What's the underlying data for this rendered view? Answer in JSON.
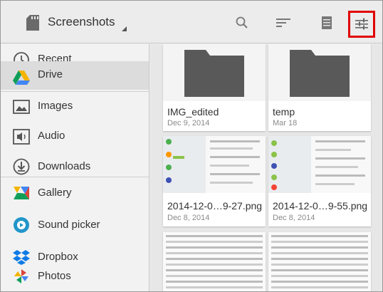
{
  "topbar": {
    "title": "Screenshots",
    "icons": [
      "sd-card-icon",
      "search-icon",
      "sort-icon",
      "list-view-icon",
      "settings-icon"
    ],
    "highlight_color": "#e00000"
  },
  "drawer": {
    "items": [
      {
        "label": "Recent",
        "icon": "clock-icon"
      },
      {
        "label": "Drive",
        "icon": "drive-icon"
      },
      {
        "label": "Images",
        "icon": "image-icon"
      },
      {
        "label": "Audio",
        "icon": "audio-icon"
      },
      {
        "label": "Downloads",
        "icon": "download-icon"
      },
      {
        "label": "Gallery",
        "icon": "gallery-icon"
      },
      {
        "label": "Sound picker",
        "icon": "sound-picker-icon"
      },
      {
        "label": "Dropbox",
        "icon": "dropbox-icon"
      },
      {
        "label": "Photos",
        "icon": "photos-icon"
      }
    ],
    "selected": "Drive"
  },
  "files": [
    {
      "name": "IMG_edited",
      "date": "Dec 9, 2014",
      "type": "folder"
    },
    {
      "name": "temp",
      "date": "Mar 18",
      "type": "folder"
    },
    {
      "name": "2014-12-0…9-27.png",
      "date": "Dec 8, 2014",
      "type": "image"
    },
    {
      "name": "2014-12-0…9-55.png",
      "date": "Dec 8, 2014",
      "type": "image"
    },
    {
      "name": "",
      "date": "",
      "type": "image"
    },
    {
      "name": "",
      "date": "",
      "type": "image"
    }
  ]
}
